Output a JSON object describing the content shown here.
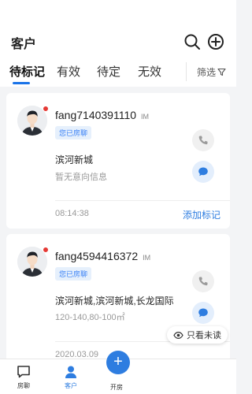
{
  "header": {
    "title": "客户",
    "search_icon": "search-icon",
    "add_icon": "plus-circle-icon"
  },
  "tabs": [
    {
      "label": "待标记",
      "active": true
    },
    {
      "label": "有效",
      "active": false
    },
    {
      "label": "待定",
      "active": false
    },
    {
      "label": "无效",
      "active": false
    }
  ],
  "filter": {
    "label": "筛选",
    "icon": "filter-funnel-icon"
  },
  "customers": [
    {
      "name": "fang7140391110",
      "im_tag": "IM",
      "badge": "您已房聊",
      "location": "滨河新城",
      "intent": "暂无意向信息",
      "time": "08:14:38",
      "action": "添加标记",
      "unread": true
    },
    {
      "name": "fang4594416372",
      "im_tag": "IM",
      "badge": "您已房聊",
      "location": "滨河新城,滨河新城,长龙国际",
      "intent": "120-140,80-100㎡",
      "time": "2020.03.09",
      "action": "",
      "unread": true
    }
  ],
  "unread_filter": {
    "label": "只看未读",
    "icon": "eye-icon"
  },
  "bottom_nav": [
    {
      "label": "房聊",
      "icon": "chat-square-icon",
      "active": false
    },
    {
      "label": "客户",
      "icon": "person-icon",
      "active": true
    },
    {
      "label": "开房",
      "icon": "plus-icon",
      "active": false
    }
  ],
  "colors": {
    "accent": "#2e7de0",
    "unread_dot": "#e53935",
    "badge_bg": "#e6f0fc"
  }
}
